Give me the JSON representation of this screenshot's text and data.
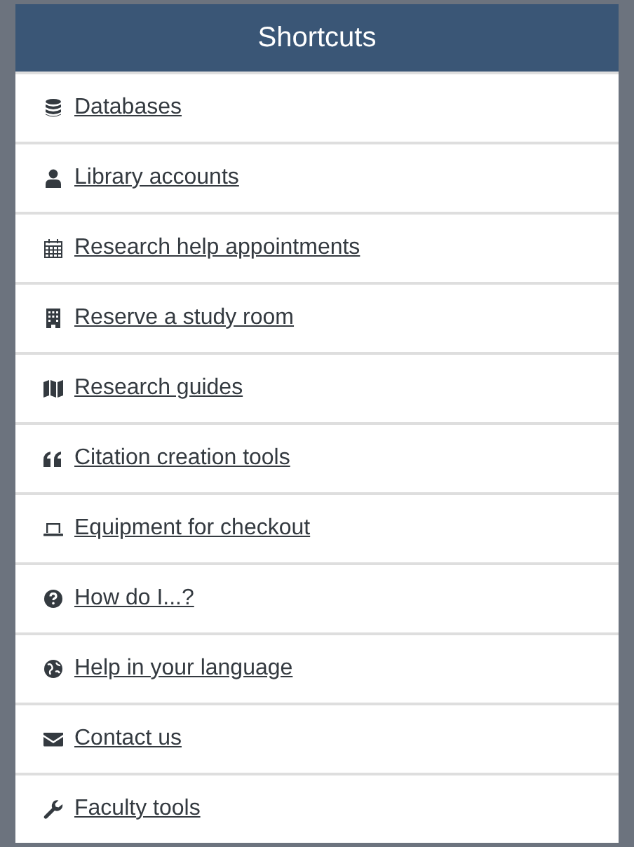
{
  "panel": {
    "title": "Shortcuts"
  },
  "links": [
    {
      "label": "Databases",
      "kind": "database"
    },
    {
      "label": "Library accounts",
      "kind": "user"
    },
    {
      "label": "Research help appointments",
      "kind": "calendar"
    },
    {
      "label": "Reserve a study room",
      "kind": "building"
    },
    {
      "label": "Research guides",
      "kind": "map"
    },
    {
      "label": "Citation creation tools",
      "kind": "quote"
    },
    {
      "label": "Equipment for checkout",
      "kind": "laptop"
    },
    {
      "label": "How do I...?",
      "kind": "question"
    },
    {
      "label": "Help in your language",
      "kind": "globe"
    },
    {
      "label": "Contact us",
      "kind": "envelope"
    },
    {
      "label": "Faculty tools",
      "kind": "wrench"
    }
  ]
}
